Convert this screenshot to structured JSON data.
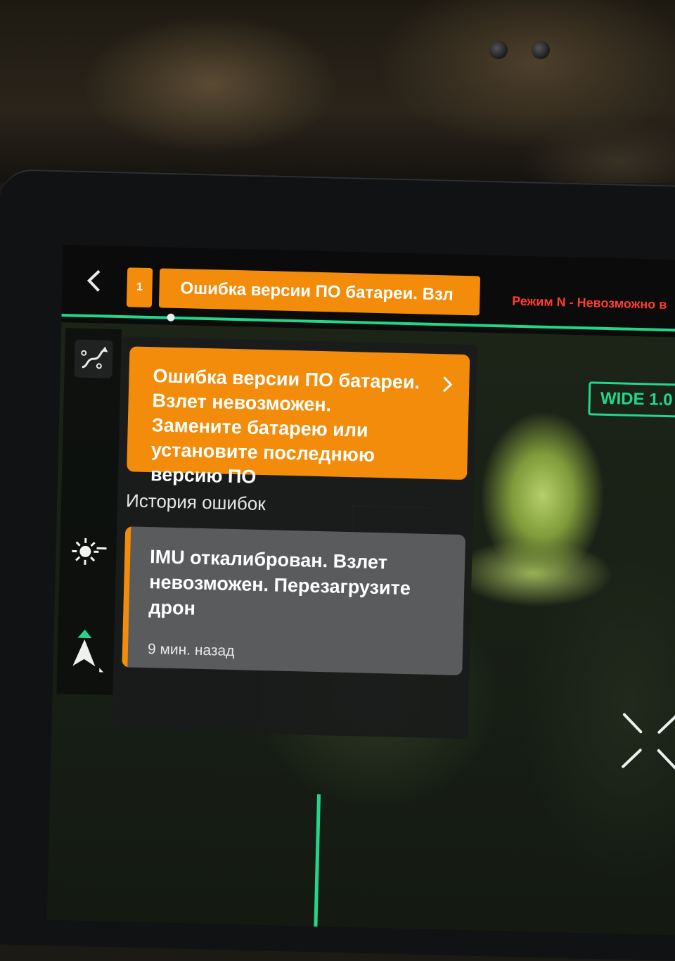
{
  "header": {
    "back_icon": "chevron-left-icon",
    "alert_count": "1",
    "alert_banner_text": "Ошибка версии ПО батареи. Взл",
    "mode_warning": "Режим N - Невозможно в"
  },
  "current_error": {
    "text": "Ошибка версии ПО батареи. Взлет невозможен. Замените батарею или установите последнюю версию ПО",
    "chevron_icon": "chevron-right-icon",
    "color": "#f28c0a"
  },
  "error_history": {
    "title": "История ошибок",
    "items": [
      {
        "text": "IMU откалиброван. Взлет невозможен. Перезагрузите дрон",
        "time": "9 мин. назад"
      }
    ]
  },
  "camera": {
    "zoom_label": "WIDE  1.0"
  },
  "sidebar": {
    "icons": [
      "route-icon",
      "exposure-sun-icon",
      "navigation-arrow-icon"
    ]
  },
  "colors": {
    "accent_green": "#22d68a",
    "alert_orange": "#f28c0a",
    "warning_red": "#ff3b30"
  }
}
